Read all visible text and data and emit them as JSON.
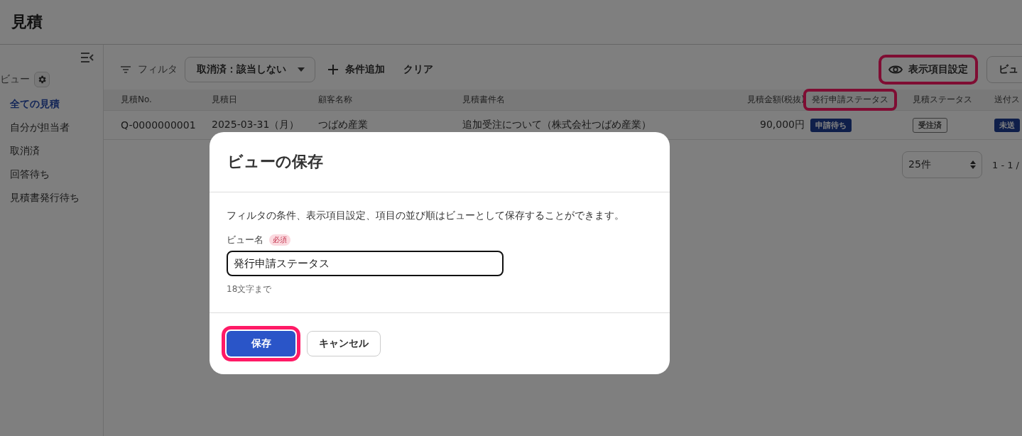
{
  "page_title": "見積",
  "sidebar": {
    "view_label": "ビュー",
    "items": [
      {
        "label": "全ての見積",
        "selected": true
      },
      {
        "label": "自分が担当者",
        "selected": false
      },
      {
        "label": "取消済",
        "selected": false
      },
      {
        "label": "回答待ち",
        "selected": false
      },
      {
        "label": "見積書発行待ち",
        "selected": false
      }
    ]
  },
  "toolbar": {
    "filter_label": "フィルタ",
    "filter_chip": "取消済：該当しない",
    "add_condition": "条件追加",
    "clear": "クリア",
    "column_settings": {
      "label": "表示項目設定",
      "highlighted": true
    },
    "view_button": "ビュ"
  },
  "table": {
    "columns": [
      {
        "label": "見積No.",
        "highlighted": false
      },
      {
        "label": "見積日",
        "highlighted": false
      },
      {
        "label": "顧客名称",
        "highlighted": false
      },
      {
        "label": "見積書件名",
        "highlighted": false
      },
      {
        "label": "見積金額(税抜)",
        "highlighted": false
      },
      {
        "label": "発行申請ステータス",
        "highlighted": true
      },
      {
        "label": "見積ステータス",
        "highlighted": false
      },
      {
        "label": "送付ス",
        "highlighted": false
      }
    ],
    "rows": [
      [
        {
          "kind": "text",
          "text": "Q-0000000001"
        },
        {
          "kind": "text",
          "text": "2025-03-31（月）"
        },
        {
          "kind": "text",
          "text": "つばめ産業"
        },
        {
          "kind": "text",
          "text": "追加受注について（株式会社つばめ産業）"
        },
        {
          "kind": "text",
          "text": "90,000円"
        },
        {
          "kind": "solid_badge",
          "text": "申請待ち"
        },
        {
          "kind": "outline_badge",
          "text": "受注済"
        },
        {
          "kind": "solid_badge",
          "text": "未送"
        }
      ]
    ]
  },
  "pagination": {
    "page_size": "25件",
    "range": "1 - 1 /"
  },
  "dialog": {
    "title": "ビューの保存",
    "description": "フィルタの条件、表示項目設定、項目の並び順はビューとして保存することができます。",
    "field_label": "ビュー名",
    "required_badge": "必須",
    "value": "発行申請ステータス",
    "hint": "18文字まで",
    "buttons": [
      {
        "label": "保存",
        "kind": "primary",
        "highlighted": true
      },
      {
        "label": "キャンセル",
        "kind": "secondary",
        "highlighted": false
      }
    ]
  }
}
